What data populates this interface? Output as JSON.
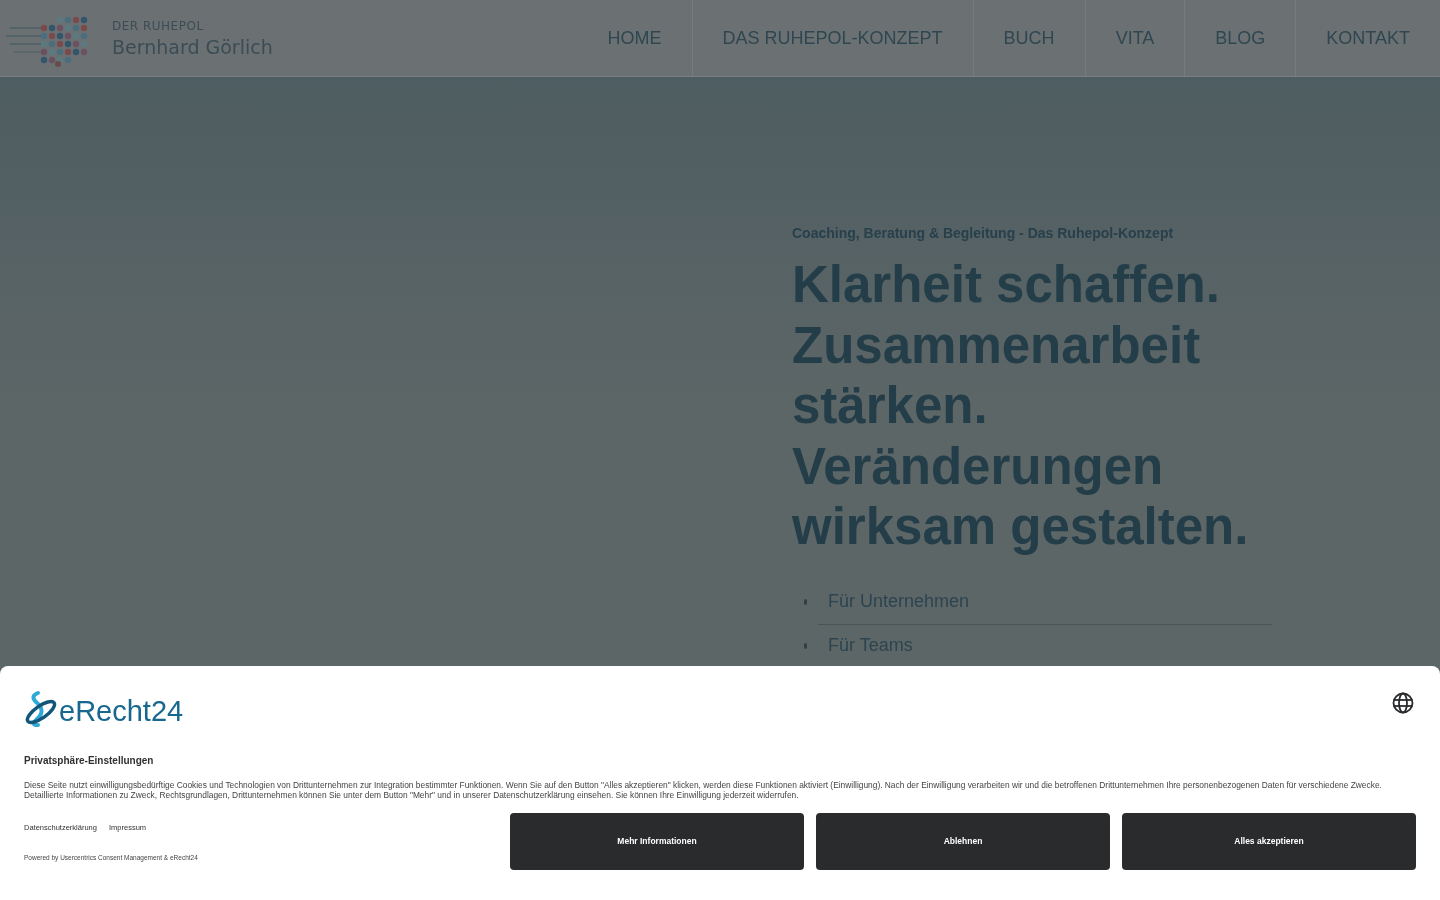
{
  "header": {
    "logo": {
      "line_1": "DER RUHEPOL",
      "line_2": "Bernhard Görlich"
    },
    "nav": [
      {
        "label": "HOME",
        "selected": false
      },
      {
        "label": "DAS RUHEPOL-KONZEPT",
        "selected": false
      },
      {
        "label": "BUCH",
        "selected": false
      },
      {
        "label": "VITA",
        "selected": false
      },
      {
        "label": "BLOG",
        "selected": false
      },
      {
        "label": "KONTAKT",
        "selected": false
      }
    ]
  },
  "hero": {
    "kicker": "Coaching, Beratung & Begleitung - Das Ruhepol-Konzept",
    "headline": [
      "Klarheit schaffen.",
      "Zusammenarbeit",
      "stärken.",
      "Veränderungen",
      "wirksam gestalten."
    ],
    "links": [
      "Für Unternehmen",
      "Für Teams"
    ]
  },
  "consent": {
    "brand": "eRecht24",
    "title": "Privatsphäre-Einstellungen",
    "text": "Diese Seite nutzt einwilligungsbedürftige Cookies und Technologien von Drittunternehmen zur Integration bestimmter Funktionen. Wenn Sie auf den Button \"Alles akzeptieren\" klicken, werden diese Funktionen aktiviert (Einwilligung). Nach der Einwilligung verarbeiten wir und die betroffenen Drittunternehmen Ihre personenbezogenen Daten für verschiedene Zwecke. Detaillierte Informationen zu Zweck, Rechtsgrundlagen, Drittunternehmen können Sie unter dem Button \"Mehr\" und in unserer Datenschutzerklärung einsehen. Sie können Ihre Einwilligung jederzeit widerrufen.",
    "links": [
      "Datenschutzerklärung",
      "Impressum"
    ],
    "powered": "Powered by Usercentrics Consent Management & eRecht24",
    "buttons": [
      "Mehr Informationen",
      "Ablehnen",
      "Alles akzeptieren"
    ]
  }
}
